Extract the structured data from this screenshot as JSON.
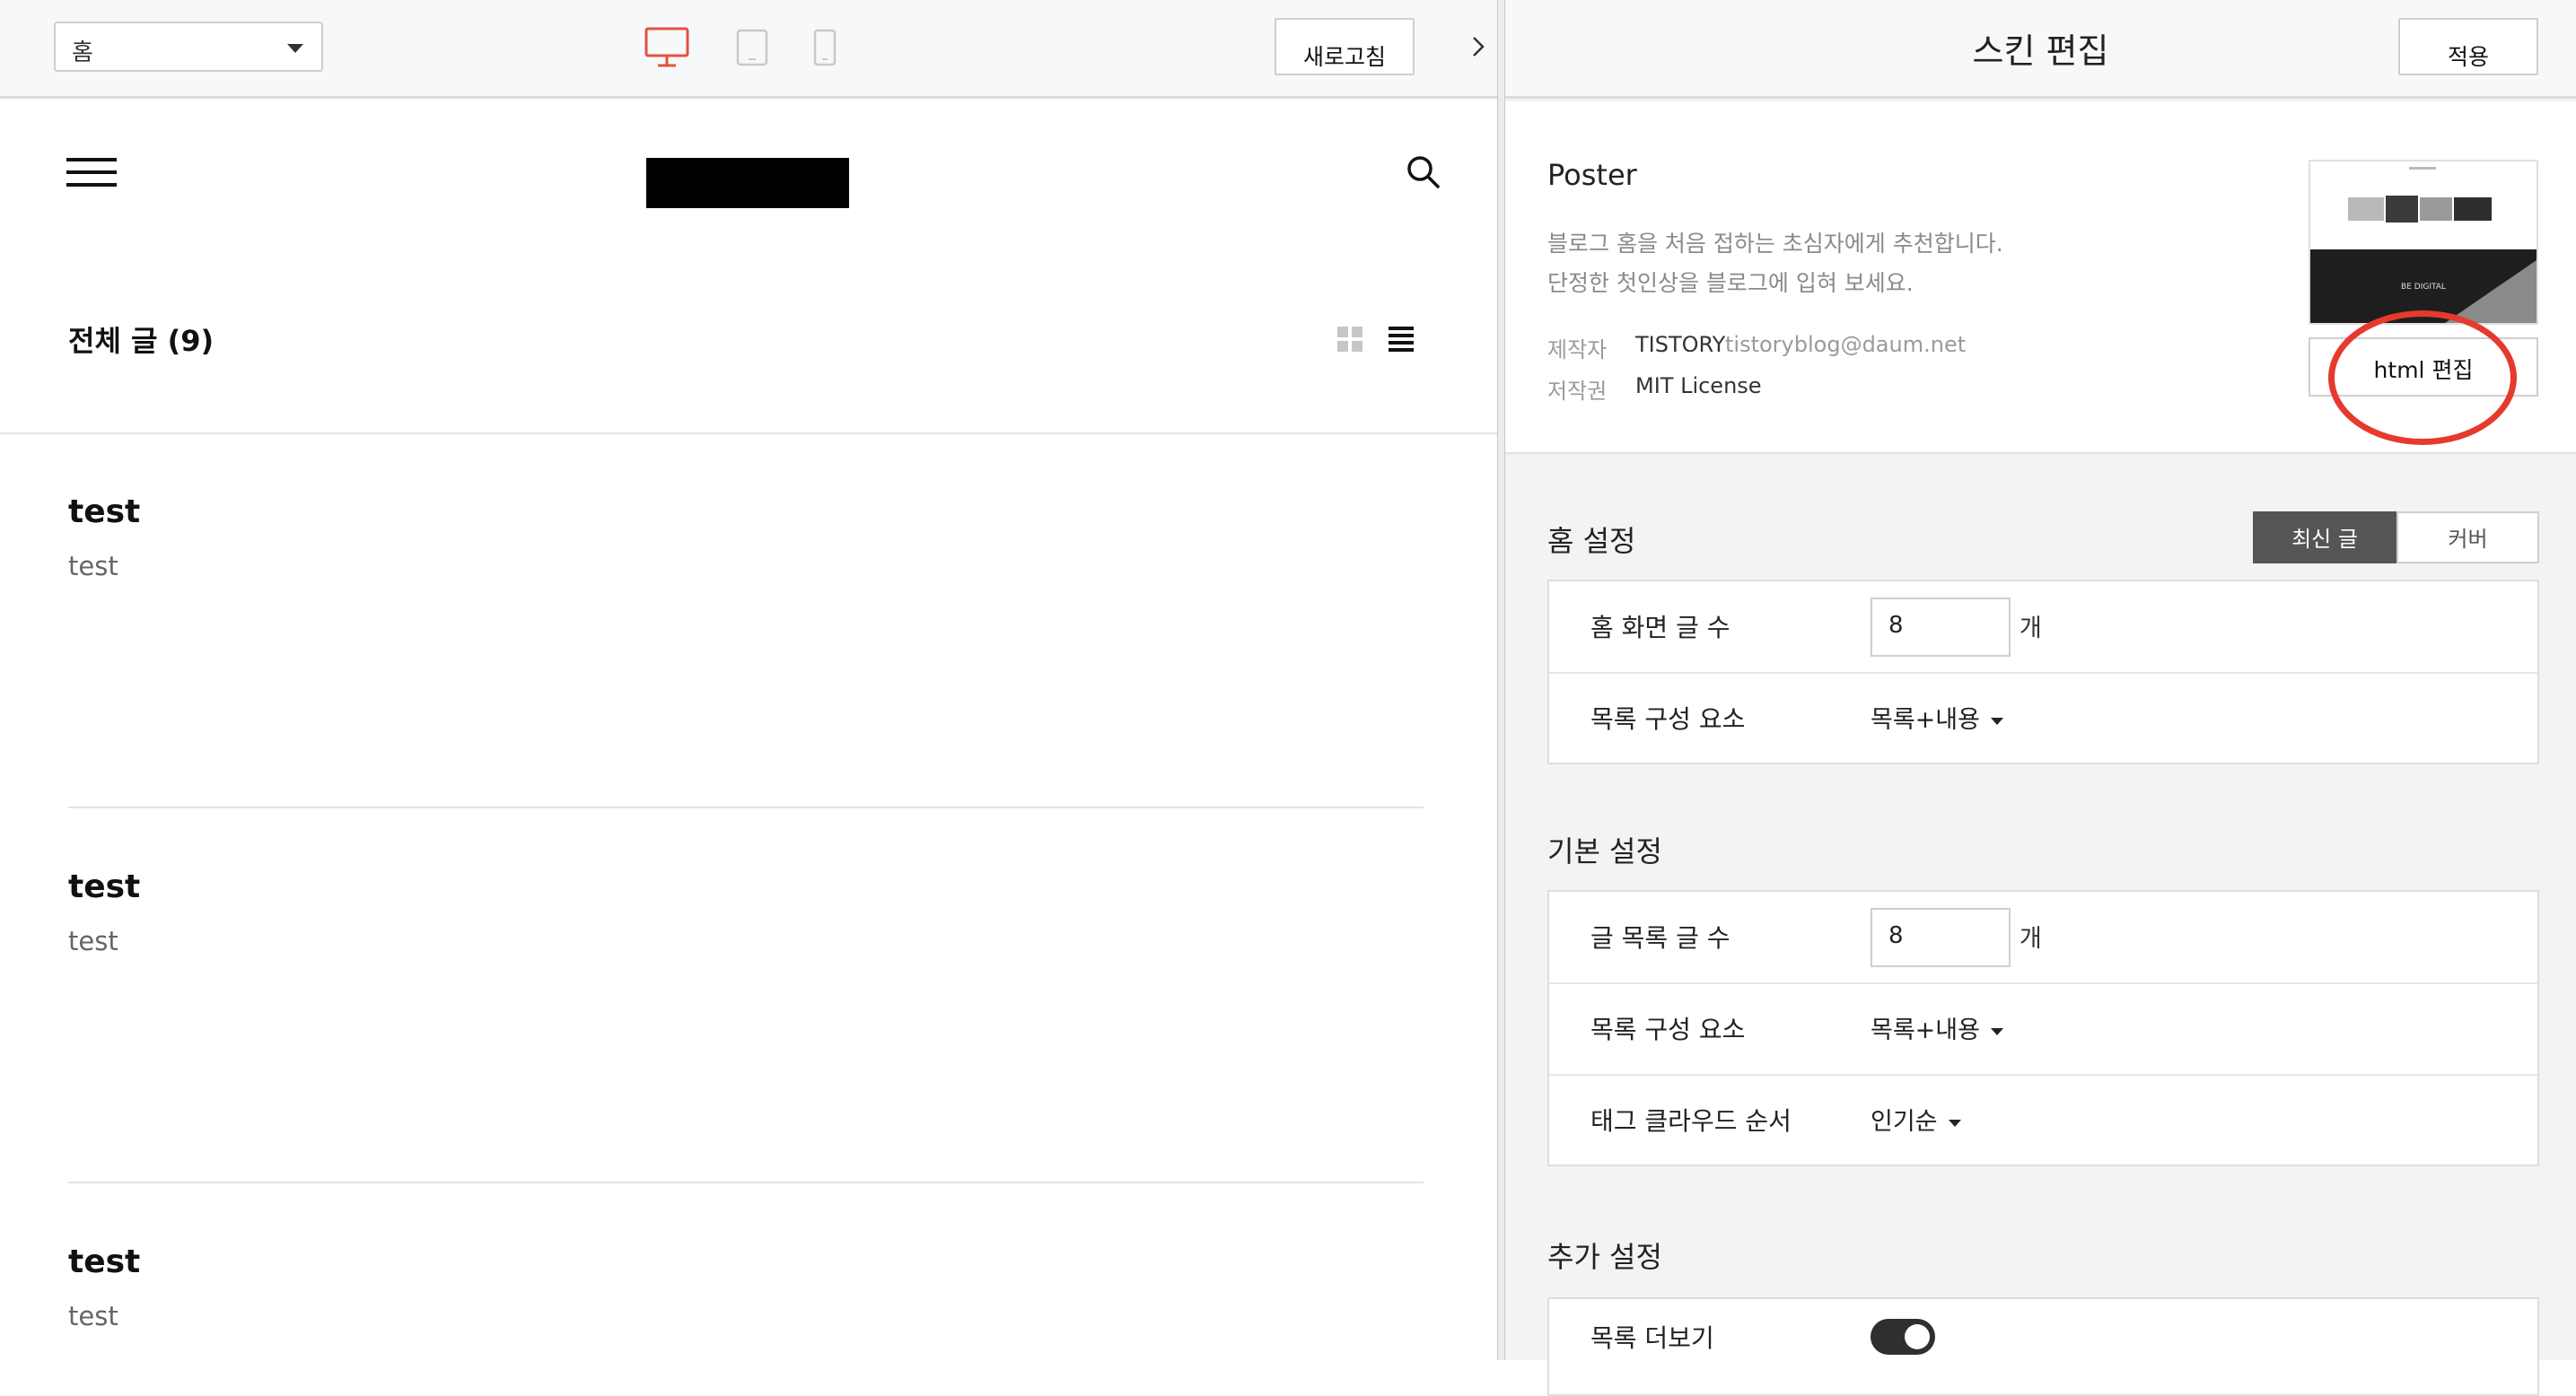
{
  "preview": {
    "page_select": "홈",
    "refresh_label": "새로고침",
    "all_posts": "전체 글 (9)",
    "posts": [
      {
        "title": "test",
        "body": "test"
      },
      {
        "title": "test",
        "body": "test"
      },
      {
        "title": "test",
        "body": "test"
      }
    ],
    "active_device": "desktop",
    "accent_color": "#e1523b"
  },
  "editor": {
    "title": "스킨 편집",
    "apply_label": "적용",
    "skin": {
      "name": "Poster",
      "desc1": "블로그 홈을 처음 접하는 초심자에게 추천합니다.",
      "desc2": "단정한 첫인상을 블로그에 입혀 보세요.",
      "author_key": "제작자",
      "author_name": "TISTORY",
      "author_email": "tistoryblog@daum.net",
      "license_key": "저작권",
      "license": "MIT License",
      "thumb_caption": "BE DIGITAL",
      "html_edit_label": "html 편집"
    },
    "home_settings": {
      "title": "홈 설정",
      "seg": [
        "최신 글",
        "커버"
      ],
      "rows": [
        {
          "label": "홈 화면 글 수",
          "value": "8",
          "unit": "개"
        },
        {
          "label": "목록 구성 요소",
          "value": "목록+내용"
        }
      ]
    },
    "basic_settings": {
      "title": "기본 설정",
      "rows": [
        {
          "label": "글 목록 글 수",
          "value": "8",
          "unit": "개"
        },
        {
          "label": "목록 구성 요소",
          "value": "목록+내용"
        },
        {
          "label": "태그 클라우드 순서",
          "value": "인기순"
        }
      ]
    },
    "extra_settings": {
      "title": "추가 설정",
      "rows": [
        {
          "label": "목록 더보기",
          "toggle": true
        }
      ]
    },
    "annotation_color": "#e53a2c"
  }
}
